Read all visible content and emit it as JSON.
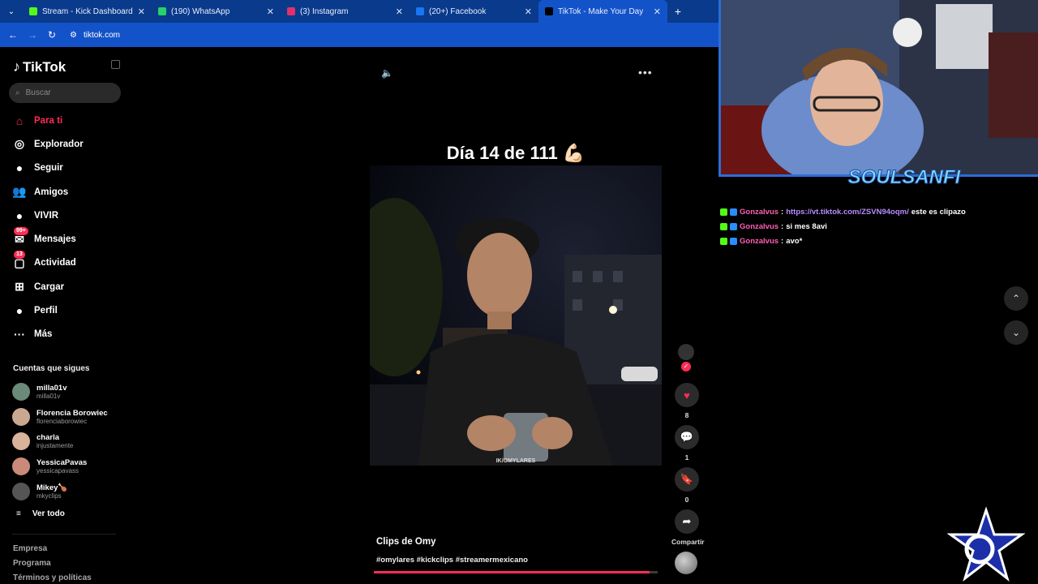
{
  "browser": {
    "tabs": [
      {
        "label": "Stream - Kick Dashboard",
        "favicon_color": "#53fc18",
        "active": false
      },
      {
        "label": "(190) WhatsApp",
        "favicon_color": "#25d366",
        "active": false
      },
      {
        "label": "(3) Instagram",
        "favicon_color": "#e1306c",
        "active": false
      },
      {
        "label": "(20+) Facebook",
        "favicon_color": "#1877f2",
        "active": false
      },
      {
        "label": "TikTok - Make Your Day",
        "favicon_color": "#000000",
        "active": true
      }
    ],
    "new_tab": "+",
    "url": "tiktok.com"
  },
  "sidebar": {
    "logo": "TikTok",
    "search_placeholder": "Buscar",
    "nav": [
      {
        "label": "Para ti",
        "icon": "home-icon",
        "glyph": "⌂",
        "active": true
      },
      {
        "label": "Explorador",
        "icon": "compass-icon",
        "glyph": "◎"
      },
      {
        "label": "Seguir",
        "icon": "following-avatar-icon",
        "glyph": "●"
      },
      {
        "label": "Amigos",
        "icon": "friends-icon",
        "glyph": "👥"
      },
      {
        "label": "VIVIR",
        "icon": "live-icon",
        "glyph": "●"
      },
      {
        "label": "Mensajes",
        "icon": "messages-icon",
        "glyph": "✉",
        "badge": "99+"
      },
      {
        "label": "Actividad",
        "icon": "activity-icon",
        "glyph": "▢",
        "badge": "13"
      },
      {
        "label": "Cargar",
        "icon": "upload-icon",
        "glyph": "⊞"
      },
      {
        "label": "Perfil",
        "icon": "profile-icon",
        "glyph": "●"
      },
      {
        "label": "Más",
        "icon": "more-icon",
        "glyph": "···"
      }
    ],
    "following_title": "Cuentas que sigues",
    "following": [
      {
        "name": "milla01v",
        "user": "milla01v",
        "color": "#6a8a7a"
      },
      {
        "name": "Florencia Borowiec",
        "user": "florenciaborowiec",
        "color": "#caa890"
      },
      {
        "name": "charla",
        "user": "injustamente",
        "color": "#d9b49a"
      },
      {
        "name": "YessicaPavas",
        "user": "yessicapavass",
        "color": "#c98a7a"
      },
      {
        "name": "Mikey🍗",
        "user": "mkyclips",
        "color": "#555555"
      }
    ],
    "see_all": "Ver todo",
    "footer": [
      "Empresa",
      "Programa",
      "Términos y políticas"
    ]
  },
  "video": {
    "caption": "Día 14 de 111 💪🏻",
    "author": "Clips de Omy",
    "tags": "#omylares #kickclips #streamermexicano",
    "progress": 0.97,
    "watermark": "IK/OMYLARES"
  },
  "actions": {
    "likes": "8",
    "comments": "1",
    "saves": "0",
    "share_label": "Compartir"
  },
  "overlay": {
    "webcam_watermark": "SOULSANFI",
    "chat": [
      {
        "user": "Gonzalvus",
        "sep": ":",
        "link": "https://vt.tiktok.com/ZSVN94oqm/",
        "text": "este es clipazo"
      },
      {
        "user": "Gonzalvus",
        "sep": ":",
        "link": "",
        "text": "si mes 8avi"
      },
      {
        "user": "Gonzalvus",
        "sep": ":",
        "link": "",
        "text": "avo*"
      }
    ]
  }
}
